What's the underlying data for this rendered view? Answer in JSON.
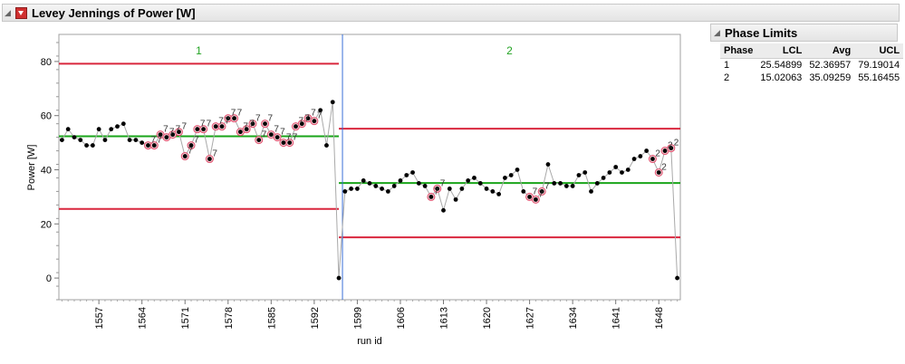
{
  "report": {
    "title": "Levey Jennings of Power [W]",
    "disclosure_glyph": "◢"
  },
  "phase_limits": {
    "title": "Phase Limits",
    "columns": [
      "Phase",
      "LCL",
      "Avg",
      "UCL"
    ],
    "rows": [
      [
        "1",
        "25.54899",
        "52.36957",
        "79.19014"
      ],
      [
        "2",
        "15.02063",
        "35.09259",
        "55.16455"
      ]
    ]
  },
  "chart_data": {
    "type": "line",
    "title": "Levey Jennings of Power [W]",
    "xlabel": "run id",
    "ylabel": "Power [W]",
    "xlim": [
      1550.5,
      1651.5
    ],
    "ylim": [
      -8,
      90
    ],
    "x_ticks": [
      1557,
      1564,
      1571,
      1578,
      1585,
      1592,
      1599,
      1606,
      1613,
      1620,
      1627,
      1634,
      1641,
      1648
    ],
    "y_ticks": [
      0,
      20,
      40,
      60,
      80
    ],
    "phase_boundary_x": 1596,
    "phases": [
      {
        "name": "1",
        "x_range": [
          1551,
          1596
        ],
        "lcl": 25.54899,
        "avg": 52.36957,
        "ucl": 79.19014
      },
      {
        "name": "2",
        "x_range": [
          1596,
          1651
        ],
        "lcl": 15.02063,
        "avg": 35.09259,
        "ucl": 55.16455
      }
    ],
    "colors": {
      "limits": "#d9263d",
      "center": "#1aa51a",
      "phase_line": "#3a6fd8",
      "points": "#000000",
      "connector": "#a9a9a9",
      "flag_ring": "#e0506e",
      "flag_fill": "#f4c9d1",
      "phase_text": "#22a322"
    },
    "flag_label": "7",
    "series": [
      {
        "x": [
          1551,
          1552,
          1553,
          1554,
          1555,
          1556,
          1557,
          1558,
          1559,
          1560,
          1561,
          1562,
          1563,
          1564,
          1565,
          1566,
          1567,
          1568,
          1569,
          1570,
          1571,
          1572,
          1573,
          1574,
          1575,
          1576,
          1577,
          1578,
          1579,
          1580,
          1581,
          1582,
          1583,
          1584,
          1585,
          1586,
          1587,
          1588,
          1589,
          1590,
          1591,
          1592,
          1593,
          1594,
          1595,
          1596
        ],
        "y": [
          51,
          55,
          52,
          51,
          49,
          49,
          55,
          51,
          55,
          56,
          57,
          51,
          51,
          50,
          49,
          49,
          53,
          52,
          53,
          54,
          45,
          49,
          55,
          55,
          44,
          56,
          56,
          59,
          59,
          54,
          55,
          57,
          51,
          57,
          53,
          52,
          50,
          50,
          56,
          57,
          59,
          58,
          62,
          49,
          65,
          0
        ],
        "flags": [
          "",
          "",
          "",
          "",
          "",
          "",
          "",
          "",
          "",
          "",
          "",
          "",
          "",
          "",
          "7",
          "7",
          "7",
          "7",
          "7",
          "7",
          "7",
          "7",
          "7",
          "7",
          "7",
          "7",
          "7",
          "7",
          "7",
          "7",
          "7",
          "7",
          "7",
          "7",
          "7",
          "7",
          "7",
          "7",
          "7",
          "7",
          "7",
          "7",
          "",
          "",
          "",
          ""
        ]
      },
      {
        "x": [
          1597,
          1598,
          1599,
          1600,
          1601,
          1602,
          1603,
          1604,
          1605,
          1606,
          1607,
          1608,
          1609,
          1610,
          1611,
          1612,
          1613,
          1614,
          1615,
          1616,
          1617,
          1618,
          1619,
          1620,
          1621,
          1622,
          1623,
          1624,
          1625,
          1626,
          1627,
          1628,
          1629,
          1630,
          1631,
          1632,
          1633,
          1634,
          1635,
          1636,
          1637,
          1638,
          1639,
          1640,
          1641,
          1642,
          1643,
          1644,
          1645,
          1646,
          1647,
          1648,
          1649,
          1650,
          1651
        ],
        "y": [
          32,
          33,
          33,
          36,
          35,
          34,
          33,
          32,
          34,
          36,
          38,
          39,
          35,
          34,
          30,
          33,
          25,
          33,
          29,
          33,
          36,
          37,
          35,
          33,
          32,
          31,
          37,
          38,
          40,
          32,
          30,
          29,
          32,
          42,
          35,
          35,
          34,
          34,
          38,
          39,
          32,
          35,
          37,
          39,
          41,
          39,
          40,
          44,
          45,
          47,
          44,
          39,
          47,
          48,
          0
        ],
        "flags": [
          "",
          "",
          "",
          "",
          "",
          "",
          "",
          "",
          "",
          "",
          "",
          "",
          "",
          "",
          "7",
          "7",
          "",
          "",
          "",
          "",
          "",
          "",
          "",
          "",
          "",
          "",
          "",
          "",
          "",
          "",
          "7",
          "7",
          "7",
          "",
          "",
          "",
          "",
          "",
          "",
          "",
          "",
          "",
          "",
          "",
          "",
          "",
          "",
          "",
          "",
          "",
          "2",
          "2",
          "2",
          "2",
          ""
        ]
      }
    ]
  }
}
